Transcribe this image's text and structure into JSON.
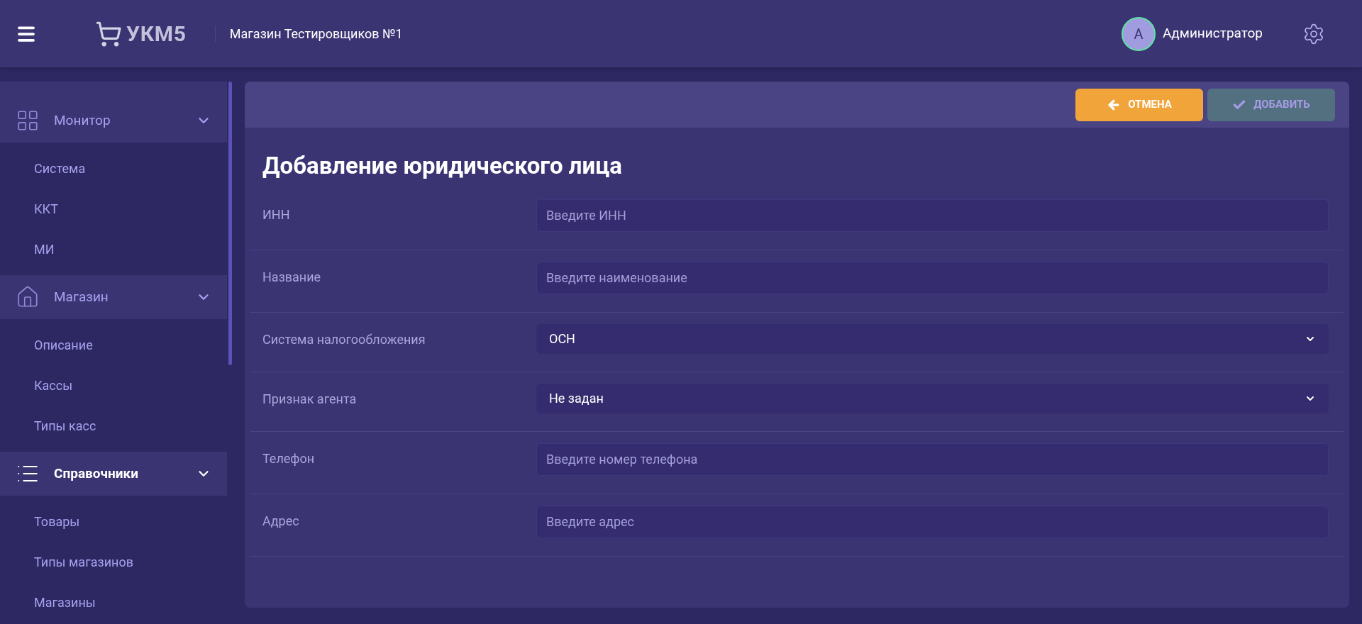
{
  "header": {
    "logo": "УКМ5",
    "store": "Магазин Тестировщиков №1",
    "user": {
      "initial": "А",
      "name": "Администратор"
    }
  },
  "sidebar": {
    "groups": [
      {
        "label": "Монитор",
        "expanded": true,
        "selected": false,
        "items": [
          "Система",
          "ККТ",
          "МИ"
        ]
      },
      {
        "label": "Магазин",
        "expanded": true,
        "selected": false,
        "items": [
          "Описание",
          "Кассы",
          "Типы касс"
        ]
      },
      {
        "label": "Справочники",
        "expanded": true,
        "selected": true,
        "items": [
          "Товары",
          "Типы магазинов",
          "Магазины"
        ]
      }
    ]
  },
  "toolbar": {
    "buttons": [
      {
        "label": "ОТМЕНА",
        "kind": "cancel",
        "disabled": false
      },
      {
        "label": "ДОБАВИТЬ",
        "kind": "add",
        "disabled": true
      }
    ]
  },
  "form": {
    "title": "Добавление юридического лица",
    "fields": [
      {
        "label": "ИНН",
        "kind": "input",
        "placeholder": "Введите ИНН"
      },
      {
        "label": "Название",
        "kind": "input",
        "placeholder": "Введите наименование"
      },
      {
        "label": "Система налогообложения",
        "kind": "select",
        "value": "ОСН"
      },
      {
        "label": "Признак агента",
        "kind": "select",
        "value": "Не задан"
      },
      {
        "label": "Телефон",
        "kind": "input",
        "placeholder": "Введите номер телефона"
      },
      {
        "label": "Адрес",
        "kind": "input",
        "placeholder": "Введите адрес"
      }
    ]
  }
}
